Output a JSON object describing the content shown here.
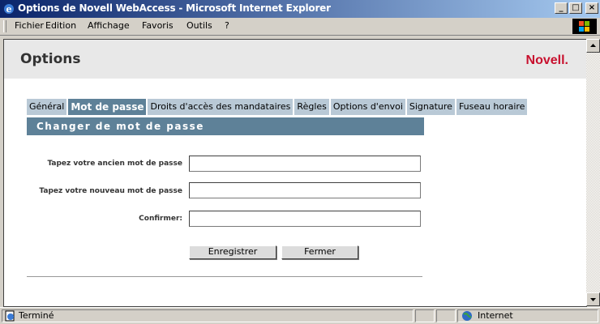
{
  "window": {
    "title": "Options de Novell WebAccess - Microsoft Internet Explorer",
    "minimize": "_",
    "maximize": "□",
    "close": "×"
  },
  "menu": {
    "items": [
      "Fichier",
      "Edition",
      "Affichage",
      "Favoris",
      "Outils",
      "?"
    ]
  },
  "page": {
    "title": "Options",
    "brand": "Novell."
  },
  "tabs": [
    "Général",
    "Mot de passe",
    "Droits d'accès des mandataires",
    "Règles",
    "Options d'envoi",
    "Signature",
    "Fuseau horaire"
  ],
  "active_tab": "Mot de passe",
  "section": {
    "title": "Changer de mot de passe"
  },
  "form": {
    "old_password_label": "Tapez votre ancien mot de passe",
    "new_password_label": "Tapez votre nouveau mot de passe",
    "confirm_label": "Confirmer:",
    "old_password_value": "",
    "new_password_value": "",
    "confirm_value": ""
  },
  "buttons": {
    "save": "Enregistrer",
    "close": "Fermer"
  },
  "status": {
    "text": "Terminé",
    "zone": "Internet"
  },
  "colors": {
    "tab_active": "#5e8198",
    "tab_inactive": "#b9c9d6",
    "brand": "#c8102e",
    "titlebar_start": "#0a246a",
    "titlebar_end": "#a6caf0"
  }
}
